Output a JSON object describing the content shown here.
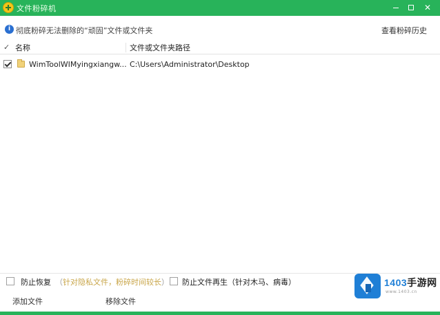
{
  "window": {
    "title": "文件粉碎机",
    "controls": {
      "minimize": "",
      "maximize": "",
      "close": "✕"
    }
  },
  "info": {
    "message": "彻底粉碎无法删除的“顽固”文件或文件夹",
    "history_link": "查看粉碎历史"
  },
  "table": {
    "columns": {
      "name": "名称",
      "path": "文件或文件夹路径"
    },
    "rows": [
      {
        "checked": true,
        "name": "WimToolWIMyingxiangw...",
        "path": "C:\\Users\\Administrator\\Desktop"
      }
    ]
  },
  "options": {
    "prevent_restore": {
      "label": "防止恢复",
      "hint_open": "（",
      "hint_a": "针对隐私文件，",
      "hint_b": "粉碎时间较长",
      "hint_close": "）"
    },
    "prevent_regen": {
      "label": "防止文件再生（针对木马、病毒）"
    }
  },
  "actions": {
    "add": "添加文件",
    "remove": "移除文件"
  },
  "watermark": {
    "brand_num": "1403",
    "brand_cn": "手游网",
    "url": "www.1403.cn"
  },
  "colors": {
    "accent": "#28b35a",
    "info_icon": "#2a6fd1",
    "watermark_blue": "#1f7fd6"
  }
}
